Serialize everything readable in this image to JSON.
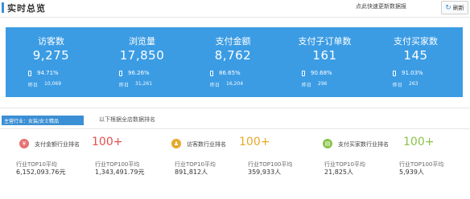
{
  "header": {
    "title": "实时总览",
    "hint": "点此快速更新数据报",
    "refresh_label": "刷新"
  },
  "stats": [
    {
      "label": "访客数",
      "value": "9,275",
      "pct": "94.71%",
      "y_label": "昨日",
      "y_value": "10,069"
    },
    {
      "label": "浏览量",
      "value": "17,850",
      "pct": "96.26%",
      "y_label": "昨日",
      "y_value": "31,261"
    },
    {
      "label": "支付金额",
      "value": "8,762",
      "pct": "86.65%",
      "y_label": "昨日",
      "y_value": "16,204"
    },
    {
      "label": "支付子订单数",
      "value": "161",
      "pct": "90.68%",
      "y_label": "昨日",
      "y_value": "296"
    },
    {
      "label": "支付买家数",
      "value": "145",
      "pct": "91.03%",
      "y_label": "昨日",
      "y_value": "263"
    }
  ],
  "industry": {
    "tab_label": "主营行业：女装/女士精品",
    "note": "以下根据全店数据排名"
  },
  "rankings": [
    {
      "icon": "¥",
      "title": "支付金额行业排名",
      "badge": "100+",
      "col1_label": "行业TOP10平均",
      "col1_value": "6,152,093.76元",
      "col2_label": "行业TOP100平均",
      "col2_value": "1,343,491.79元"
    },
    {
      "icon": "♟",
      "title": "访客数行业排名",
      "badge": "100+",
      "col1_label": "行业TOP10平均",
      "col1_value": "891,812人",
      "col2_label": "行业TOP100平均",
      "col2_value": "359,933人"
    },
    {
      "icon": "▤",
      "title": "支付买家数行业排名",
      "badge": "100+",
      "col1_label": "行业TOP10平均",
      "col1_value": "21,825人",
      "col2_label": "行业TOP100平均",
      "col2_value": "5,939人"
    }
  ],
  "colors": {
    "panel_blue": "#3b9ce4",
    "accent_blue": "#3b8fd4",
    "money_icon": "#e57373",
    "visitor_icon": "#e5a92b",
    "buyer_icon": "#8bc34a",
    "badge_red": "#e0504f",
    "badge_orange": "#e5a92b",
    "badge_green": "#8bc34a"
  }
}
